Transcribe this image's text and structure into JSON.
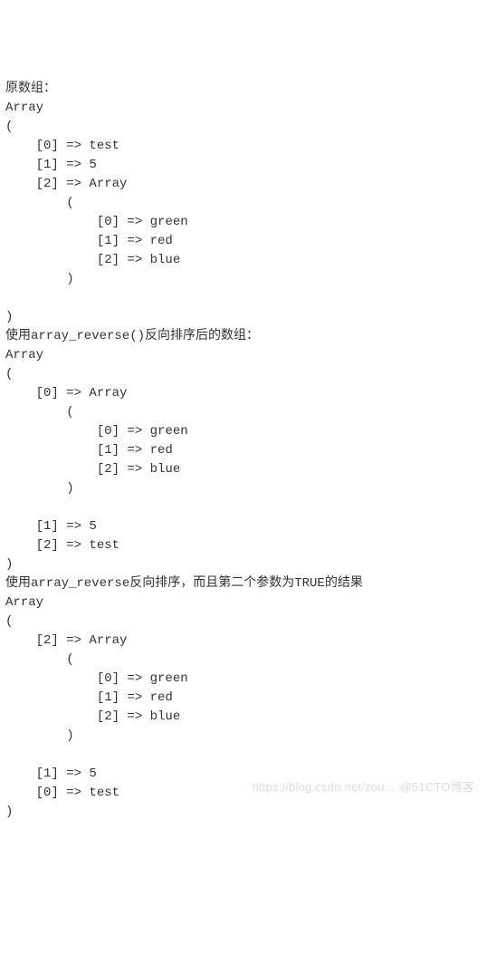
{
  "sections": [
    {
      "label": "原数组：",
      "array": {
        "entries": [
          {
            "key": "0",
            "type": "scalar",
            "value": "test"
          },
          {
            "key": "1",
            "type": "scalar",
            "value": "5"
          },
          {
            "key": "2",
            "type": "array",
            "entries": [
              {
                "key": "0",
                "type": "scalar",
                "value": "green"
              },
              {
                "key": "1",
                "type": "scalar",
                "value": "red"
              },
              {
                "key": "2",
                "type": "scalar",
                "value": "blue"
              }
            ]
          }
        ]
      }
    },
    {
      "label": "使用array_reverse()反向排序后的数组：",
      "array": {
        "entries": [
          {
            "key": "0",
            "type": "array",
            "entries": [
              {
                "key": "0",
                "type": "scalar",
                "value": "green"
              },
              {
                "key": "1",
                "type": "scalar",
                "value": "red"
              },
              {
                "key": "2",
                "type": "scalar",
                "value": "blue"
              }
            ]
          },
          {
            "key": "1",
            "type": "scalar",
            "value": "5"
          },
          {
            "key": "2",
            "type": "scalar",
            "value": "test"
          }
        ]
      }
    },
    {
      "label": "使用array_reverse反向排序，而且第二个参数为TRUE的结果",
      "array": {
        "entries": [
          {
            "key": "2",
            "type": "array",
            "entries": [
              {
                "key": "0",
                "type": "scalar",
                "value": "green"
              },
              {
                "key": "1",
                "type": "scalar",
                "value": "red"
              },
              {
                "key": "2",
                "type": "scalar",
                "value": "blue"
              }
            ]
          },
          {
            "key": "1",
            "type": "scalar",
            "value": "5"
          },
          {
            "key": "0",
            "type": "scalar",
            "value": "test"
          }
        ]
      }
    }
  ],
  "watermark": "https://blog.csdn.net/zou… @51CTO博客"
}
